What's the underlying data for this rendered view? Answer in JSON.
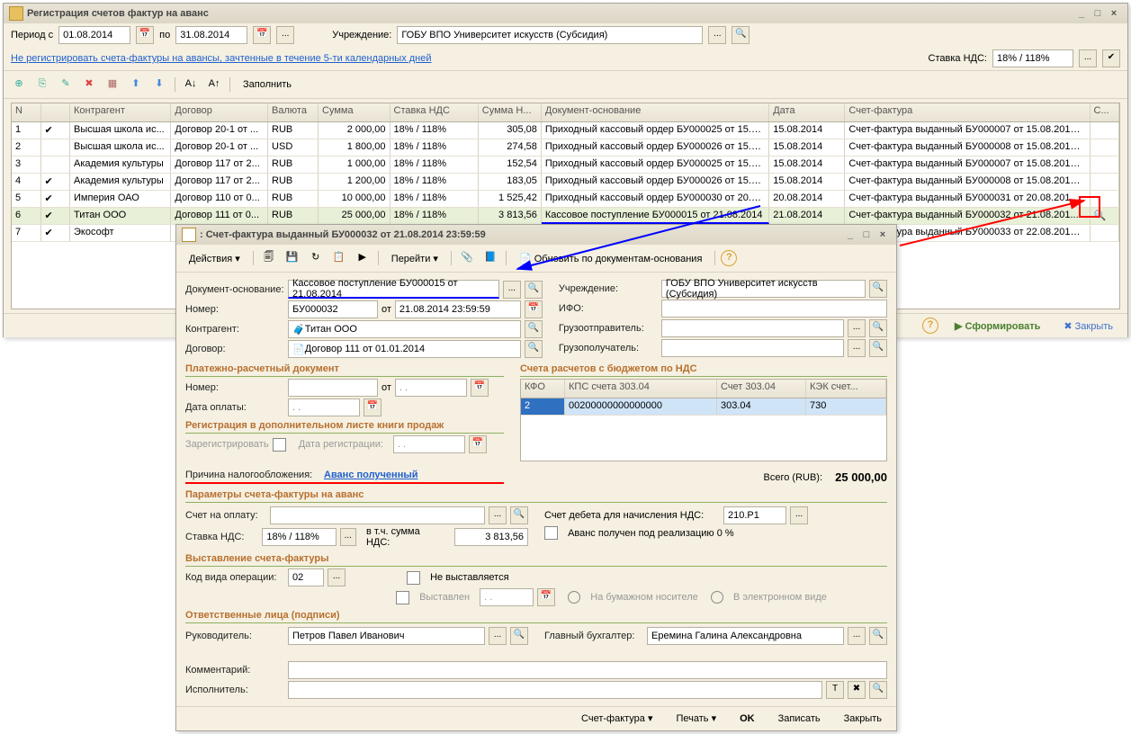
{
  "main": {
    "title": "Регистрация счетов фактур на аванс",
    "period_label": "Период с",
    "period_from": "01.08.2014",
    "period_to_label": "по",
    "period_to": "31.08.2014",
    "org_label": "Учреждение:",
    "org_value": "ГОБУ ВПО Университет искусств (Субсидия)",
    "link_text": "Не регистрировать счета-фактуры на авансы, зачтенные в течение 5-ти календарных дней",
    "vat_label": "Ставка НДС:",
    "vat_value": "18% / 118%",
    "fill_btn": "Заполнить",
    "columns": [
      "N",
      "",
      "Контрагент",
      "Договор",
      "Валюта",
      "Сумма",
      "Ставка НДС",
      "Сумма Н...",
      "Документ-основание",
      "Дата",
      "Счет-фактура",
      "С..."
    ],
    "rows": [
      {
        "n": "1",
        "chk": true,
        "ka": "Высшая школа ис...",
        "dog": "Договор 20-1 от ...",
        "val": "RUB",
        "sum": "2 000,00",
        "nds": "18% / 118%",
        "snds": "305,08",
        "doc": "Приходный кассовый ордер БУ000025 от 15.08...",
        "date": "15.08.2014",
        "sf": "Счет-фактура выданный БУ000007 от 15.08.2014 23..."
      },
      {
        "n": "2",
        "chk": false,
        "ka": "Высшая школа ис...",
        "dog": "Договор 20-1 от ...",
        "val": "USD",
        "sum": "1 800,00",
        "nds": "18% / 118%",
        "snds": "274,58",
        "doc": "Приходный кассовый ордер БУ000026 от 15.08...",
        "date": "15.08.2014",
        "sf": "Счет-фактура выданный БУ000008 от 15.08.2014 23..."
      },
      {
        "n": "3",
        "chk": false,
        "ka": "Академия культуры",
        "dog": "Договор 117 от 2...",
        "val": "RUB",
        "sum": "1 000,00",
        "nds": "18% / 118%",
        "snds": "152,54",
        "doc": "Приходный кассовый ордер БУ000025 от 15.08...",
        "date": "15.08.2014",
        "sf": "Счет-фактура выданный БУ000007 от 15.08.2014 23..."
      },
      {
        "n": "4",
        "chk": true,
        "ka": "Академия культуры",
        "dog": "Договор 117 от 2...",
        "val": "RUB",
        "sum": "1 200,00",
        "nds": "18% / 118%",
        "snds": "183,05",
        "doc": "Приходный кассовый ордер БУ000026 от 15.08...",
        "date": "15.08.2014",
        "sf": "Счет-фактура выданный БУ000008 от 15.08.2014 23..."
      },
      {
        "n": "5",
        "chk": true,
        "ka": "Империя ОАО",
        "dog": "Договор 110 от 0...",
        "val": "RUB",
        "sum": "10 000,00",
        "nds": "18% / 118%",
        "snds": "1 525,42",
        "doc": "Приходный кассовый ордер БУ000030 от 20.08...",
        "date": "20.08.2014",
        "sf": "Счет-фактура выданный БУ000031 от 20.08.2014 23..."
      },
      {
        "n": "6",
        "chk": true,
        "ka": "Титан ООО",
        "dog": "Договор 111 от 0...",
        "val": "RUB",
        "sum": "25 000,00",
        "nds": "18% / 118%",
        "snds": "3 813,56",
        "doc": "Кассовое поступление БУ000015 от 21.08.2014",
        "date": "21.08.2014",
        "sf": "Счет-фактура выданный БУ000032 от 21.08.201..."
      },
      {
        "n": "7",
        "chk": true,
        "ka": "Экософт",
        "dog": "",
        "val": "",
        "sum": "",
        "nds": "",
        "snds": "",
        "doc": "",
        "date": "",
        "sf": "Счет-фактура выданный БУ000033 от 22.08.2014 23..."
      }
    ],
    "form_btn": "Сформировать",
    "close_btn": "Закрыть"
  },
  "dlg": {
    "title": ": Счет-фактура выданный БУ000032 от 21.08.2014 23:59:59",
    "actions": "Действия",
    "goto": "Перейти",
    "update": "Обновить по документам-основания",
    "doc_osn_label": "Документ-основание:",
    "doc_osn_value": "Кассовое поступление БУ000015 от 21.08.2014",
    "nomer_label": "Номер:",
    "nomer_value": "БУ000032",
    "from_label": "от",
    "nomer_date": "21.08.2014 23:59:59",
    "ka_label": "Контрагент:",
    "ka_value": "Титан ООО",
    "dog_label": "Договор:",
    "dog_value": "Договор 111 от 01.01.2014",
    "org_label": "Учреждение:",
    "org_value": "ГОБУ ВПО Университет искусств (Субсидия)",
    "ifo_label": "ИФО:",
    "shipper_label": "Грузоотправитель:",
    "consignee_label": "Грузополучатель:",
    "sec_pay": "Платежно-расчетный документ",
    "pay_num_label": "Номер:",
    "pay_date_label": "Дата оплаты:",
    "sec_reg": "Регистрация в дополнительном листе книги продаж",
    "reg_label": "Зарегистрировать",
    "reg_date_label": "Дата регистрации:",
    "reason_label": "Причина налогообложения:",
    "reason_value": "Аванс полученный",
    "sec_acc": "Счета расчетов с бюджетом по НДС",
    "acc_cols": [
      "КФО",
      "КПС счета 303.04",
      "Счет 303.04",
      "КЭК счет..."
    ],
    "acc_row": [
      "2",
      "00200000000000000",
      "303.04",
      "730"
    ],
    "total_label": "Всего (RUB):",
    "total_value": "25 000,00",
    "sec_params": "Параметры счета-фактуры на аванс",
    "acc_pay_label": "Счет на оплату:",
    "nds_label": "Ставка НДС:",
    "nds_value": "18% / 118%",
    "nds_sum_label": "в т.ч. сумма НДС:",
    "nds_sum_value": "3 813,56",
    "debit_label": "Счет дебета для начисления НДС:",
    "debit_value": "210.Р1",
    "advance_chk": "Аванс получен под реализацию 0 %",
    "sec_issue": "Выставление счета-фактуры",
    "op_code_label": "Код вида операции:",
    "op_code_value": "02",
    "not_issued": "Не выставляется",
    "issued": "Выставлен",
    "paper": "На бумажном носителе",
    "electronic": "В электронном виде",
    "sec_sign": "Ответственные лица (подписи)",
    "head_label": "Руководитель:",
    "head_value": "Петров Павел Иванович",
    "acc_label": "Главный бухгалтер:",
    "acc_value": "Еремина Галина Александровна",
    "comment_label": "Комментарий:",
    "performer_label": "Исполнитель:",
    "sf_btn": "Счет-фактура",
    "print_btn": "Печать",
    "ok_btn": "OK",
    "save_btn": "Записать",
    "close_btn": "Закрыть"
  }
}
